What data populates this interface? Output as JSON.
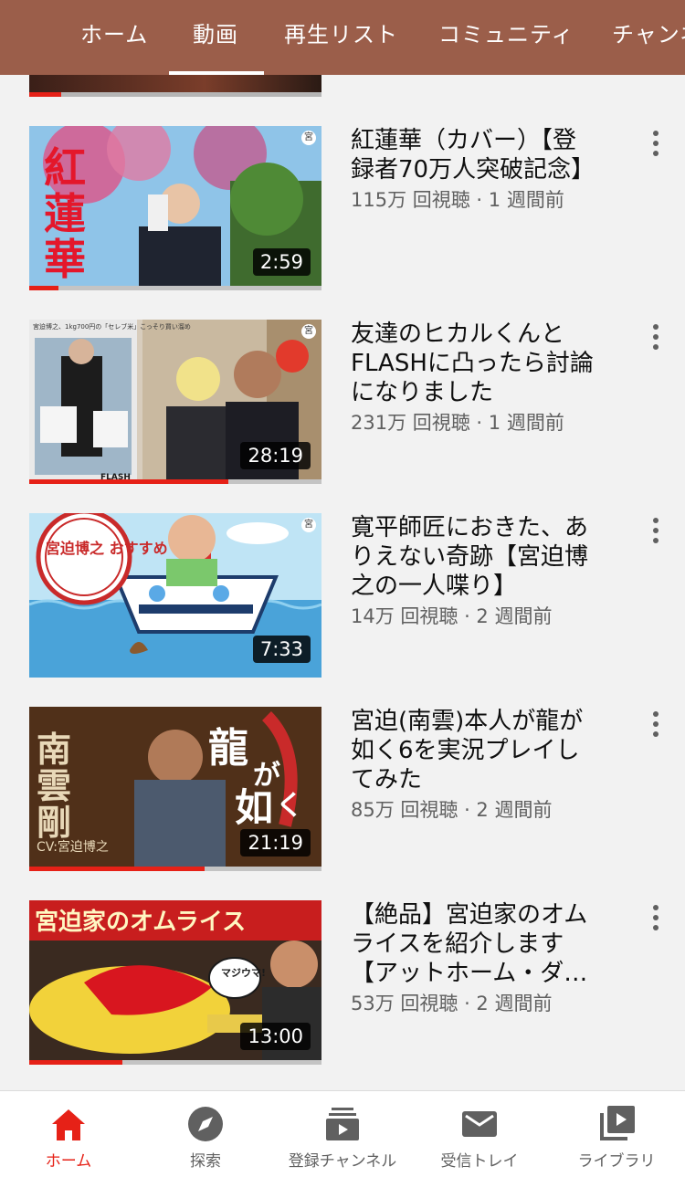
{
  "header": {
    "tabs": [
      {
        "label": "ホーム",
        "active": false
      },
      {
        "label": "動画",
        "active": true
      },
      {
        "label": "再生リスト",
        "active": false
      },
      {
        "label": "コミュニティ",
        "active": false
      },
      {
        "label": "チャンネル",
        "active": false
      }
    ],
    "background": "#9b5e4a"
  },
  "videos": [
    {
      "thumb_text": "紅蓮華",
      "thumb_badge": "宮",
      "duration": "2:59",
      "watched_fraction": 0.1,
      "title_line1": "紅蓮華（カバー）【登",
      "title_line2": "録者70万人突破記念】",
      "views": "115万 回視聴 · 1 週間前"
    },
    {
      "thumb_text": "FLASH",
      "thumb_badge": "宮",
      "duration": "28:19",
      "watched_fraction": 0.68,
      "title_line1": "友達のヒカルくんと",
      "title_line2": "FLASHに凸ったら討論",
      "title_line3": "になりました",
      "views": "231万 回視聴 · 1 週間前"
    },
    {
      "thumb_text": "宮迫博之 おすすめ",
      "thumb_badge": "宮",
      "duration": "7:33",
      "watched_fraction": 0,
      "title_line1": "寛平師匠におきた、あ",
      "title_line2": "りえない奇跡【宮迫博",
      "title_line3": "之の一人喋り】",
      "views": "14万 回視聴 · 2 週間前"
    },
    {
      "thumb_text": "南雲剛 龍が如く6",
      "thumb_sub": "CV:宮迫博之",
      "duration": "21:19",
      "watched_fraction": 0.6,
      "title_line1": "宮迫(南雲)本人が龍が",
      "title_line2": "如く6を実況プレイし",
      "title_line3": "てみた",
      "views": "85万 回視聴 · 2 週間前"
    },
    {
      "thumb_text": "宮迫家のオムライス",
      "thumb_sub": "マジウマ!",
      "duration": "13:00",
      "watched_fraction": 0.32,
      "title_line1": "【絶品】宮迫家のオム",
      "title_line2": "ライスを紹介します",
      "title_line3": "【アットホーム・ダ…",
      "views": "53万 回視聴 · 2 週間前"
    }
  ],
  "bottom_nav": [
    {
      "label": "ホーム",
      "icon": "home-icon",
      "active": true
    },
    {
      "label": "探索",
      "icon": "explore-icon",
      "active": false
    },
    {
      "label": "登録チャンネル",
      "icon": "subscriptions-icon",
      "active": false
    },
    {
      "label": "受信トレイ",
      "icon": "inbox-icon",
      "active": false
    },
    {
      "label": "ライブラリ",
      "icon": "library-icon",
      "active": false
    }
  ],
  "colors": {
    "accent": "#e62117",
    "meta_text": "#606060"
  }
}
